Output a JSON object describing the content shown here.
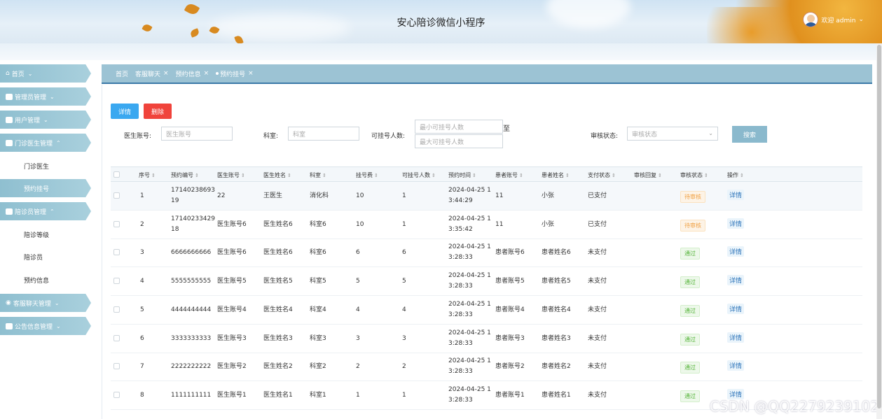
{
  "header": {
    "title": "安心陪诊微信小程序",
    "welcome": "欢迎 admin"
  },
  "sidebar": {
    "items": [
      {
        "label": "首页"
      },
      {
        "label": "管理员管理"
      },
      {
        "label": "用户管理"
      },
      {
        "label": "门诊医生管理"
      },
      {
        "label": "门诊医生"
      },
      {
        "label": "预约挂号"
      },
      {
        "label": "陪诊员管理"
      },
      {
        "label": "陪诊等级"
      },
      {
        "label": "陪诊员"
      },
      {
        "label": "预约信息"
      },
      {
        "label": "客服聊天管理"
      },
      {
        "label": "公告信息管理"
      }
    ]
  },
  "tabs": [
    {
      "label": "首页"
    },
    {
      "label": "客服聊天"
    },
    {
      "label": "预约信息"
    },
    {
      "label": "预约挂号"
    }
  ],
  "toolbar": {
    "detail": "详情",
    "delete": "删除"
  },
  "filters": {
    "doctor_account_label": "医生账号:",
    "doctor_account_placeholder": "医生账号",
    "dept_label": "科室:",
    "dept_placeholder": "科室",
    "capacity_label": "可挂号人数:",
    "capacity_min_placeholder": "最小可挂号人数",
    "capacity_max_placeholder": "最大可挂号人数",
    "to": "至",
    "status_label": "审核状态:",
    "status_placeholder": "审核状态",
    "search": "搜索"
  },
  "table": {
    "columns": [
      "序号",
      "预约编号",
      "医生账号",
      "医生姓名",
      "科室",
      "挂号费",
      "可挂号人数",
      "预约时间",
      "患者账号",
      "患者姓名",
      "支付状态",
      "审核回复",
      "审核状态",
      "操作"
    ],
    "rows": [
      {
        "no": "1",
        "code1": "17140238693",
        "code2": "19",
        "doc_acc": "22",
        "doc_name": "王医生",
        "dept": "消化科",
        "fee": "10",
        "cap": "1",
        "time1": "2024-04-25 1",
        "time2": "3:44:29",
        "pat_acc": "11",
        "pat_name": "小张",
        "pay": "已支付",
        "status": "待审核",
        "action": "详情"
      },
      {
        "no": "2",
        "code1": "17140233429",
        "code2": "18",
        "doc_acc": "医生账号6",
        "doc_name": "医生姓名6",
        "dept": "科室6",
        "fee": "10",
        "cap": "1",
        "time1": "2024-04-25 1",
        "time2": "3:35:42",
        "pat_acc": "11",
        "pat_name": "小张",
        "pay": "已支付",
        "status": "待审核",
        "action": "详情"
      },
      {
        "no": "3",
        "code1": "6666666666",
        "code2": "",
        "doc_acc": "医生账号6",
        "doc_name": "医生姓名6",
        "dept": "科室6",
        "fee": "6",
        "cap": "6",
        "time1": "2024-04-25 1",
        "time2": "3:28:33",
        "pat_acc": "患者账号6",
        "pat_name": "患者姓名6",
        "pay": "未支付",
        "status": "通过",
        "action": "详情"
      },
      {
        "no": "4",
        "code1": "5555555555",
        "code2": "",
        "doc_acc": "医生账号5",
        "doc_name": "医生姓名5",
        "dept": "科室5",
        "fee": "5",
        "cap": "5",
        "time1": "2024-04-25 1",
        "time2": "3:28:33",
        "pat_acc": "患者账号5",
        "pat_name": "患者姓名5",
        "pay": "未支付",
        "status": "通过",
        "action": "详情"
      },
      {
        "no": "5",
        "code1": "4444444444",
        "code2": "",
        "doc_acc": "医生账号4",
        "doc_name": "医生姓名4",
        "dept": "科室4",
        "fee": "4",
        "cap": "4",
        "time1": "2024-04-25 1",
        "time2": "3:28:33",
        "pat_acc": "患者账号4",
        "pat_name": "患者姓名4",
        "pay": "未支付",
        "status": "通过",
        "action": "详情"
      },
      {
        "no": "6",
        "code1": "3333333333",
        "code2": "",
        "doc_acc": "医生账号3",
        "doc_name": "医生姓名3",
        "dept": "科室3",
        "fee": "3",
        "cap": "3",
        "time1": "2024-04-25 1",
        "time2": "3:28:33",
        "pat_acc": "患者账号3",
        "pat_name": "患者姓名3",
        "pay": "未支付",
        "status": "通过",
        "action": "详情"
      },
      {
        "no": "7",
        "code1": "2222222222",
        "code2": "",
        "doc_acc": "医生账号2",
        "doc_name": "医生姓名2",
        "dept": "科室2",
        "fee": "2",
        "cap": "2",
        "time1": "2024-04-25 1",
        "time2": "3:28:33",
        "pat_acc": "患者账号2",
        "pat_name": "患者姓名2",
        "pay": "未支付",
        "status": "通过",
        "action": "详情"
      },
      {
        "no": "8",
        "code1": "1111111111",
        "code2": "",
        "doc_acc": "医生账号1",
        "doc_name": "医生姓名1",
        "dept": "科室1",
        "fee": "1",
        "cap": "1",
        "time1": "2024-04-25 1",
        "time2": "3:28:33",
        "pat_acc": "患者账号1",
        "pat_name": "患者姓名1",
        "pay": "未支付",
        "status": "通过",
        "action": "详情"
      }
    ]
  },
  "watermark": "CSDN @QQ2279239102"
}
